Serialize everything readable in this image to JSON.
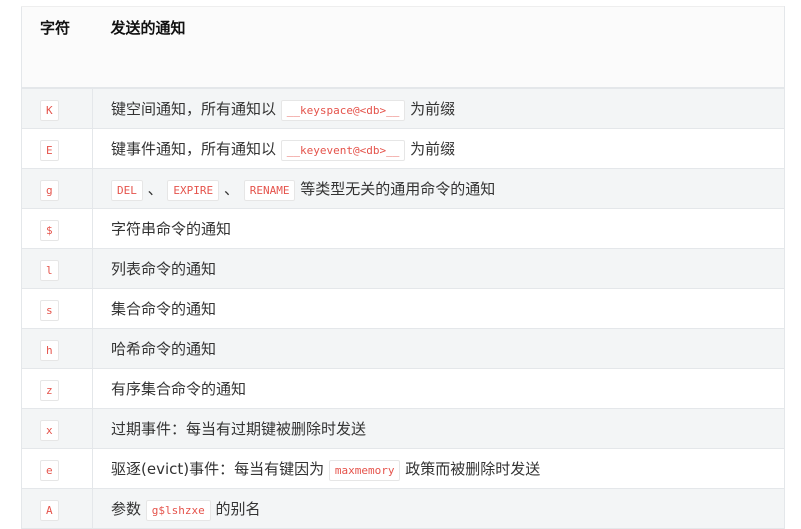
{
  "headers": [
    "字符",
    "发送的通知"
  ],
  "rows": [
    {
      "char": "K",
      "parts": [
        {
          "t": "键空间通知，所有通知以 "
        },
        {
          "c": "__keyspace@<db>__"
        },
        {
          "t": " 为前缀"
        }
      ]
    },
    {
      "char": "E",
      "parts": [
        {
          "t": "键事件通知，所有通知以 "
        },
        {
          "c": "__keyevent@<db>__"
        },
        {
          "t": " 为前缀"
        }
      ]
    },
    {
      "char": "g",
      "parts": [
        {
          "c": "DEL"
        },
        {
          "t": " 、 "
        },
        {
          "c": "EXPIRE"
        },
        {
          "t": " 、 "
        },
        {
          "c": "RENAME"
        },
        {
          "t": " 等类型无关的通用命令的通知"
        }
      ]
    },
    {
      "char": "$",
      "parts": [
        {
          "t": "字符串命令的通知"
        }
      ]
    },
    {
      "char": "l",
      "parts": [
        {
          "t": "列表命令的通知"
        }
      ]
    },
    {
      "char": "s",
      "parts": [
        {
          "t": "集合命令的通知"
        }
      ]
    },
    {
      "char": "h",
      "parts": [
        {
          "t": "哈希命令的通知"
        }
      ]
    },
    {
      "char": "z",
      "parts": [
        {
          "t": "有序集合命令的通知"
        }
      ]
    },
    {
      "char": "x",
      "parts": [
        {
          "t": "过期事件：每当有过期键被删除时发送"
        }
      ]
    },
    {
      "char": "e",
      "parts": [
        {
          "t": "驱逐(evict)事件：每当有键因为 "
        },
        {
          "c": "maxmemory"
        },
        {
          "t": " 政策而被删除时发送"
        }
      ]
    },
    {
      "char": "A",
      "parts": [
        {
          "t": "参数 "
        },
        {
          "c": "g$lshzxe"
        },
        {
          "t": " 的别名"
        }
      ]
    }
  ]
}
